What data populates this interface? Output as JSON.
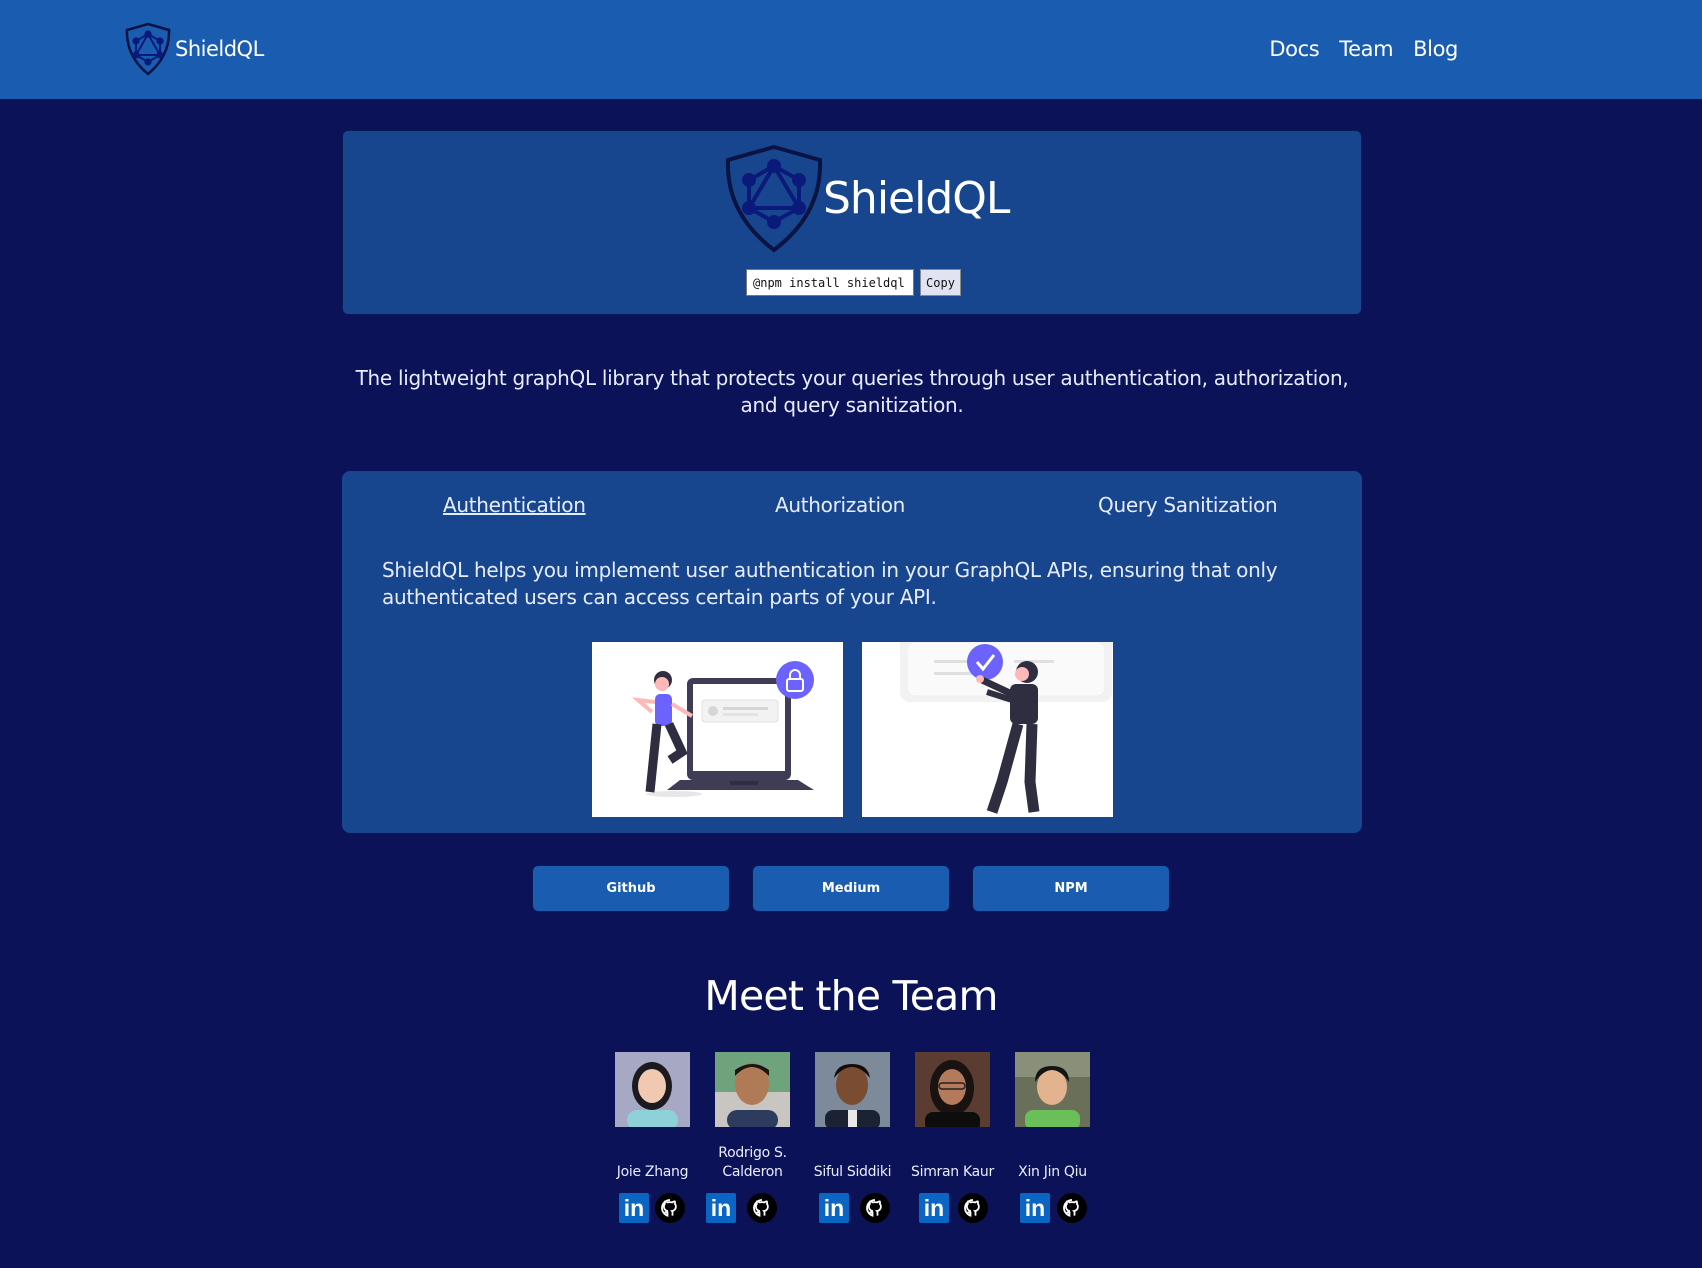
{
  "header": {
    "brand": "ShieldQL",
    "nav": [
      "Docs",
      "Team",
      "Blog"
    ]
  },
  "hero": {
    "title": "ShieldQL",
    "install_command": "@npm install shieldql",
    "copy_label": "Copy"
  },
  "tagline": "The lightweight graphQL library that protects your queries through user authentication, authorization, and query sanitization.",
  "features": {
    "tabs": [
      "Authentication",
      "Authorization",
      "Query Sanitization"
    ],
    "active_tab": "Authentication",
    "description": "ShieldQL helps you implement user authentication in your GraphQL APIs, ensuring that only authenticated users can access certain parts of your API."
  },
  "links": [
    "Github",
    "Medium",
    "NPM"
  ],
  "team": {
    "title": "Meet the Team",
    "members": [
      {
        "name": "Joie Zhang"
      },
      {
        "name": "Rodrigo S. Calderon"
      },
      {
        "name": "Siful Siddiki"
      },
      {
        "name": "Simran Kaur"
      },
      {
        "name": "Xin Jin Qiu"
      }
    ]
  },
  "colors": {
    "page_bg": "#0b1257",
    "header_bg": "#1a5cb0",
    "panel_bg": "#17468f",
    "accent_purple": "#6c63ff",
    "linkedin": "#0a66c2"
  },
  "icons": [
    "shield-logo-icon",
    "linkedin-icon",
    "github-icon",
    "lock-icon",
    "check-icon"
  ]
}
